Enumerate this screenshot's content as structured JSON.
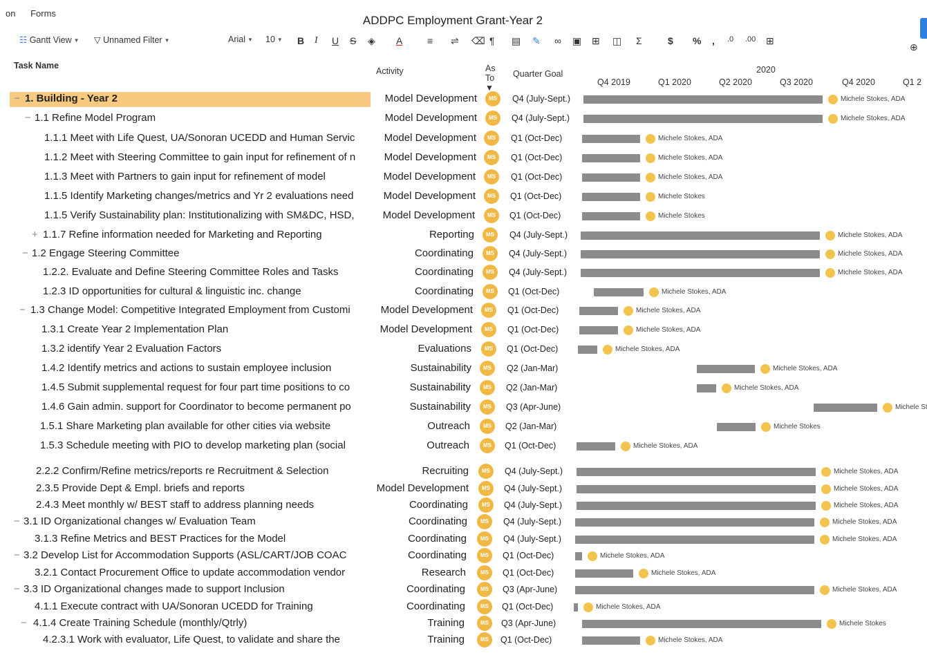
{
  "menu": [
    "on",
    "Forms"
  ],
  "document_title": "ADDPC Employment Grant-Year 2",
  "toolbar": {
    "gantt_view": "Gantt View",
    "filter": "Unnamed Filter",
    "font": "Arial",
    "font_size": "10",
    "bold": "B",
    "italic": "I",
    "underline": "U",
    "strike": "S",
    "text_color": "A",
    "sum": "Σ",
    "currency": "$",
    "percent": "%",
    "comma": ",",
    "dec_less": ".0",
    "dec_more": ".00"
  },
  "columns": {
    "task_name": "Task Name",
    "activity": "Activity",
    "assigned_to_line1": "As",
    "assigned_to_line2": "To",
    "quarter_goal": "Quarter Goal"
  },
  "timeline": {
    "year": "2020",
    "quarters": [
      "Q4 2019",
      "Q1 2020",
      "Q2 2020",
      "Q3 2020",
      "Q4 2020",
      "Q1 2"
    ]
  },
  "rows": [
    {
      "task": "1. Building - Year 2",
      "toggle": "−",
      "activity": "Model Development",
      "assignee": "MS",
      "quarter": "Q4 (July-Sept.)",
      "resource": "Michele Stokes, ADA",
      "bar_start": 0.0,
      "bar_end": 1.35
    },
    {
      "task": "1.1 Refine Model Program",
      "toggle": "−",
      "activity": "Model Development",
      "assignee": "MS",
      "quarter": "Q4 (July-Sept.)",
      "resource": "Michele Stokes, ADA",
      "bar_start": 0.0,
      "bar_end": 1.35
    },
    {
      "task": "1.1.1 Meet with Life Quest, UA/Sonoran UCEDD and Human Servic",
      "toggle": "",
      "activity": "Model Development",
      "assignee": "MS",
      "quarter": "Q1 (Oct-Dec)",
      "resource": "Michele Stokes, ADA",
      "bar_start": 0.0,
      "bar_end": 0.33
    },
    {
      "task": "1.1.2 Meet with Steering Committee to gain input for refinement of n",
      "toggle": "",
      "activity": "Model Development",
      "assignee": "MS",
      "quarter": "Q1 (Oct-Dec)",
      "resource": "Michele Stokes, ADA",
      "bar_start": 0.0,
      "bar_end": 0.33
    },
    {
      "task": "1.1.3 Meet with Partners to gain input for refinement of model",
      "toggle": "",
      "activity": "Model Development",
      "assignee": "MS",
      "quarter": "Q1 (Oct-Dec)",
      "resource": "Michele Stokes, ADA",
      "bar_start": 0.0,
      "bar_end": 0.33
    },
    {
      "task": "1.1.5 Identify Marketing changes/metrics and Yr 2 evaluations need",
      "toggle": "",
      "activity": "Model Development",
      "assignee": "MS",
      "quarter": "Q1 (Oct-Dec)",
      "resource": "Michele Stokes",
      "bar_start": 0.0,
      "bar_end": 0.33
    },
    {
      "task": "1.1.5 Verify Sustainability plan: Institutionalizing with SM&DC, HSD,",
      "toggle": "",
      "activity": "Model Development",
      "assignee": "MS",
      "quarter": "Q1 (Oct-Dec)",
      "resource": "Michele Stokes",
      "bar_start": 0.0,
      "bar_end": 0.33
    },
    {
      "task": "1.1.7 Refine information needed for Marketing and Reporting",
      "toggle": "+",
      "activity": "Reporting",
      "assignee": "MS",
      "quarter": "Q4 (July-Sept.)",
      "resource": "Michele Stokes, ADA",
      "bar_start": 0.0,
      "bar_end": 1.35
    },
    {
      "task": "1.2 Engage Steering Committee",
      "toggle": "−",
      "activity": "Coordinating",
      "assignee": "MS",
      "quarter": "Q4 (July-Sept.)",
      "resource": "Michele Stokes, ADA",
      "bar_start": 0.0,
      "bar_end": 1.35
    },
    {
      "task": "1.2.2. Evaluate and Define Steering Committee Roles and Tasks",
      "toggle": "",
      "activity": "Coordinating",
      "assignee": "MS",
      "quarter": "Q4 (July-Sept.)",
      "resource": "Michele Stokes, ADA",
      "bar_start": 0.0,
      "bar_end": 1.35
    },
    {
      "task": "1.2.3 ID opportunities for cultural & linguistic inc. change",
      "toggle": "",
      "activity": "Coordinating",
      "assignee": "MS",
      "quarter": "Q1 (Oct-Dec)",
      "resource": "Michele Stokes, ADA",
      "bar_start": 0.05,
      "bar_end": 0.33
    },
    {
      "task": "1.3 Change Model: Competitive Integrated Employment from Customi",
      "toggle": "−",
      "activity": "Model Development",
      "assignee": "MS",
      "quarter": "Q1 (Oct-Dec)",
      "resource": "Michele Stokes, ADA",
      "bar_start": 0.0,
      "bar_end": 0.22
    },
    {
      "task": "1.3.1 Create Year 2 Implementation Plan",
      "toggle": "",
      "activity": "Model Development",
      "assignee": "MS",
      "quarter": "Q1 (Oct-Dec)",
      "resource": "Michele Stokes, ADA",
      "bar_start": 0.0,
      "bar_end": 0.22
    },
    {
      "task": "1.3.2 identify Year 2 Evaluation Factors",
      "toggle": "",
      "activity": "Evaluations",
      "assignee": "MS",
      "quarter": "Q1 (Oct-Dec)",
      "resource": "Michele Stokes, ADA",
      "bar_start": 0.0,
      "bar_end": 0.11
    },
    {
      "task": "1.4.2 Identify metrics and actions to sustain employee inclusion",
      "toggle": "",
      "activity": "Sustainability",
      "assignee": "MS",
      "quarter": "Q2 (Jan-Mar)",
      "resource": "Michele Stokes, ADA",
      "bar_start": 0.33,
      "bar_end": 0.66
    },
    {
      "task": "1.4.5 Submit supplemental request for four part time positions to co",
      "toggle": "",
      "activity": "Sustainability",
      "assignee": "MS",
      "quarter": "Q2 (Jan-Mar)",
      "resource": "Michele Stokes, ADA",
      "bar_start": 0.33,
      "bar_end": 0.44
    },
    {
      "task": "1.4.6 Gain admin. support for Coordinator to become permanent po",
      "toggle": "",
      "activity": "Sustainability",
      "assignee": "MS",
      "quarter": "Q3 (Apr-June)",
      "resource": "Michele Stokes, ADA",
      "bar_start": 0.99,
      "bar_end": 1.35
    },
    {
      "task": "1.5.1 Share Marketing plan available for other cities via website",
      "toggle": "",
      "activity": "Outreach",
      "assignee": "MS",
      "quarter": "Q2 (Jan-Mar)",
      "resource": "Michele Stokes",
      "bar_start": 0.44,
      "bar_end": 0.66
    },
    {
      "task": "1.5.3 Schedule meeting with PIO to develop marketing plan (social",
      "toggle": "",
      "activity": "Outreach",
      "assignee": "MS",
      "quarter": "Q1 (Oct-Dec)",
      "resource": "Michele Stokes, ADA",
      "bar_start": 0.0,
      "bar_end": 0.22
    },
    {
      "task": "2.2.2 Confirm/Refine metrics/reports re Recruitment & Selection",
      "toggle": "",
      "activity": "Recruiting",
      "assignee": "MS",
      "quarter": "Q4 (July-Sept.)",
      "resource": "Michele Stokes, ADA",
      "bar_start": 0.0,
      "bar_end": 1.35
    },
    {
      "task": "2.3.5 Provide Dept & Empl. briefs and reports",
      "toggle": "",
      "activity": "Model Development",
      "assignee": "MS",
      "quarter": "Q4 (July-Sept.)",
      "resource": "Michele Stokes, ADA",
      "bar_start": 0.0,
      "bar_end": 1.35
    },
    {
      "task": "2.4.3 Meet monthly w/ BEST staff to address planning needs",
      "toggle": "",
      "activity": "Coordinating",
      "assignee": "MS",
      "quarter": "Q4 (July-Sept.)",
      "resource": "Michele Stokes, ADA",
      "bar_start": 0.0,
      "bar_end": 1.35
    },
    {
      "task": "3.1 ID Organizational changes w/ Evaluation Team",
      "toggle": "−",
      "activity": "Coordinating",
      "assignee": "MS",
      "quarter": "Q4 (July-Sept.)",
      "resource": "Michele Stokes, ADA",
      "bar_start": 0.0,
      "bar_end": 1.35
    },
    {
      "task": "3.1.3 Refine Metrics and BEST Practices for the Model",
      "toggle": "",
      "activity": "Coordinating",
      "assignee": "MS",
      "quarter": "Q4 (July-Sept.)",
      "resource": "Michele Stokes, ADA",
      "bar_start": 0.0,
      "bar_end": 1.35
    },
    {
      "task": "3.2 Develop List for Accommodation Supports (ASL/CART/JOB COAC",
      "toggle": "−",
      "activity": "Coordinating",
      "assignee": "MS",
      "quarter": "Q1 (Oct-Dec)",
      "resource": "Michele Stokes, ADA",
      "bar_start": 0.0,
      "bar_end": 0.04
    },
    {
      "task": "3.2.1 Contact Procurement Office to update accommodation vendor",
      "toggle": "",
      "activity": "Research",
      "assignee": "MS",
      "quarter": "Q1 (Oct-Dec)",
      "resource": "Michele Stokes, ADA",
      "bar_start": 0.0,
      "bar_end": 0.33
    },
    {
      "task": "3.3 ID Organizational changes made to support Inclusion",
      "toggle": "−",
      "activity": "Coordinating",
      "assignee": "MS",
      "quarter": "Q3 (Apr-June)",
      "resource": "Michele Stokes, ADA",
      "bar_start": 0.0,
      "bar_end": 1.35
    },
    {
      "task": "4.1.1 Execute contract with UA/Sonoran UCEDD for Training",
      "toggle": "",
      "activity": "Coordinating",
      "assignee": "MS",
      "quarter": "Q1 (Oct-Dec)",
      "resource": "Michele Stokes, ADA",
      "bar_start": 0.0,
      "bar_end": 0.02
    },
    {
      "task": "4.1.4 Create Training Schedule (monthly/Qtrly)",
      "toggle": "−",
      "activity": "Training",
      "assignee": "MS",
      "quarter": "Q3 (Apr-June)",
      "resource": "Michele Stokes",
      "bar_start": 0.0,
      "bar_end": 1.35
    },
    {
      "task": "4.2.3.1 Work with evaluator, Life Quest, to validate and share the",
      "toggle": "",
      "activity": "Training",
      "assignee": "MS",
      "quarter": "Q1 (Oct-Dec)",
      "resource": "Michele Stokes, ADA",
      "bar_start": 0.0,
      "bar_end": 0.33
    }
  ],
  "colors": {
    "highlight_row": "#f7c981",
    "avatar": "#f2b844",
    "bar": "#8c8c8c",
    "accent_blue": "#2f7fe0"
  }
}
